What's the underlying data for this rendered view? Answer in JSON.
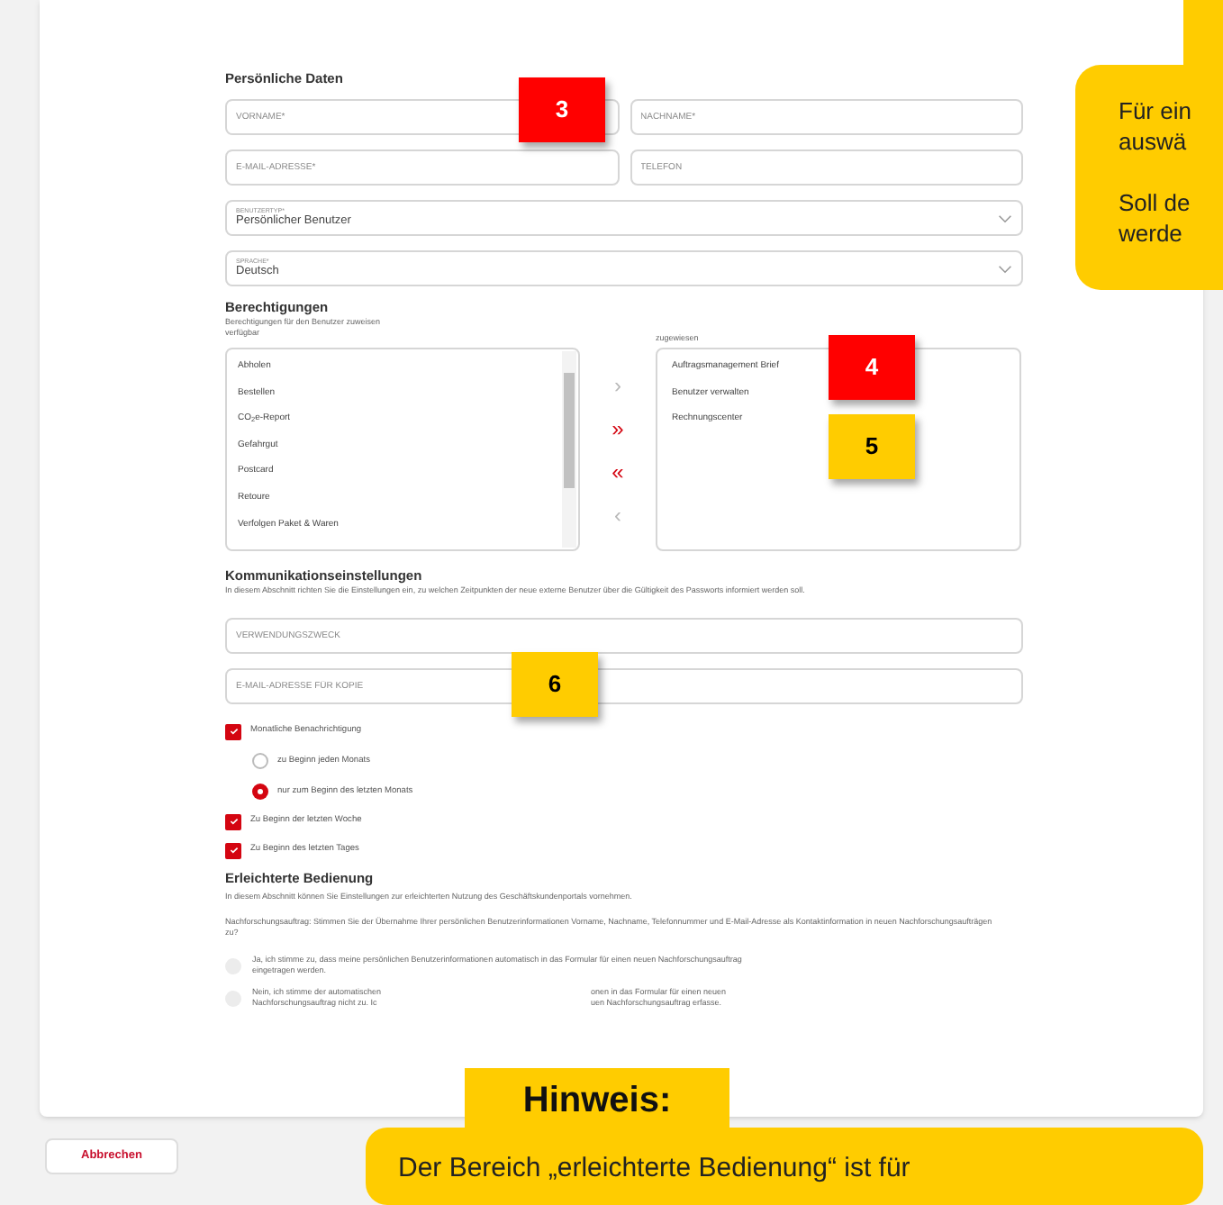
{
  "personal": {
    "title": "Persönliche Daten",
    "fields": [
      {
        "placeholder": "VORNAME*"
      },
      {
        "placeholder": "NACHNAME*"
      },
      {
        "placeholder": "E-MAIL-ADRESSE*"
      },
      {
        "placeholder": "TELEFON"
      }
    ],
    "selects": [
      {
        "label": "BENUTZERTYP*",
        "value": "Persönlicher Benutzer"
      },
      {
        "label": "SPRACHE*",
        "value": "Deutsch"
      }
    ]
  },
  "permissions": {
    "title": "Berechtigungen",
    "subtitle": "Berechtigungen für den Benutzer zuweisen",
    "available_label": "verfügbar",
    "assigned_label": "zugewiesen",
    "available": [
      "Abholen",
      "Bestellen",
      "CO$_{2}$e-Report",
      "Gefahrgut",
      "Postcard",
      "Retoure",
      "Verfolgen Paket & Waren"
    ],
    "assigned": [
      "Auftragsmanagement Brief",
      "Benutzer verwalten",
      "Rechnungscenter"
    ],
    "move_buttons": [
      {
        "symbol": "›",
        "disabled": true
      },
      {
        "symbol": "»",
        "disabled": false
      },
      {
        "symbol": "«",
        "disabled": false
      },
      {
        "symbol": "‹",
        "disabled": true
      }
    ]
  },
  "communication": {
    "title": "Kommunikationseinstellungen",
    "description": "In diesem Abschnitt richten Sie die Einstellungen ein, zu welchen Zeitpunkten der neue externe Benutzer über die Gültigkeit des Passworts informiert werden soll.",
    "fields": [
      {
        "placeholder": "VERWENDUNGSZWECK"
      },
      {
        "placeholder": "E-MAIL-ADRESSE FÜR KOPIE"
      }
    ],
    "options": [
      {
        "kind": "checkbox",
        "label": "Monatliche Benachrichtigung",
        "checked": true
      },
      {
        "kind": "radio",
        "label": "zu Beginn jeden Monats",
        "selected": false
      },
      {
        "kind": "radio",
        "label": "nur zum Beginn des letzten Monats",
        "selected": true
      },
      {
        "kind": "checkbox",
        "label": "Zu Beginn der letzten Woche",
        "checked": true
      },
      {
        "kind": "checkbox",
        "label": "Zu Beginn des letzten Tages",
        "checked": true
      }
    ]
  },
  "ease_of_use": {
    "title": "Erleichterte Bedienung",
    "description": "In diesem Abschnitt können Sie Einstellungen zur erleichterten Nutzung des Geschäftskundenportals vornehmen.",
    "question": "Nachforschungsauftrag: Stimmen Sie der Übernahme Ihrer persönlichen Benutzerinformationen Vorname, Nachname, Telefonnummer und E-Mail-Adresse als Kontaktinformation in neuen Nachforschungsaufträgen zu?",
    "answers": [
      {
        "selected": false,
        "lines": [
          {
            "left": "Ja, ich stimme zu, dass meine persönlichen Benutzerinformationen automatisch in das Formular für einen neuen Nachforschungsauftrag"
          },
          {
            "left": "eingetragen werden."
          }
        ]
      },
      {
        "selected": false,
        "lines": [
          {
            "left": "Nein, ich stimme der automatischen",
            "right": "onen in das Formular für einen neuen"
          },
          {
            "left": "Nachforschungsauftrag nicht zu. Ic",
            "right": "uen Nachforschungsauftrag erfasse."
          }
        ]
      }
    ]
  },
  "footer": {
    "cancel_button": "Abbrechen"
  },
  "callouts": [
    {
      "label": "3",
      "color": "#ff0000"
    },
    {
      "label": "4",
      "color": "#ff0000"
    },
    {
      "label": "5",
      "color": "#ffcc00"
    },
    {
      "label": "6",
      "color": "#ffcc00"
    }
  ],
  "tooltip": {
    "lines": [
      "Für ein",
      "auswä",
      "Soll de",
      "werde"
    ]
  },
  "hint": {
    "title": "Hinweis:",
    "text": "Der Bereich „erleichterte Bedienung“ ist für"
  }
}
